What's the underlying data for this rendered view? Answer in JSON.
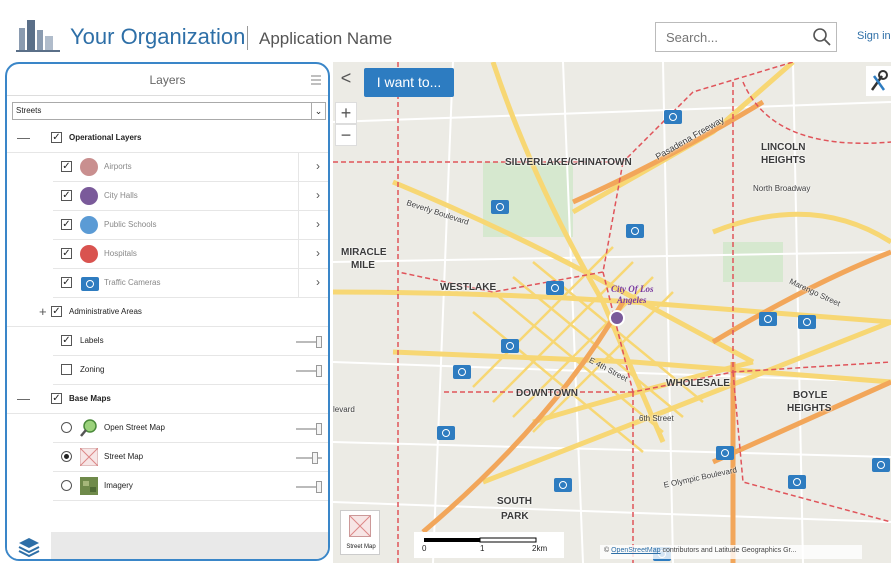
{
  "header": {
    "org_name": "Your Organization",
    "app_name": "Application Name",
    "search_placeholder": "Search...",
    "signin": "Sign in"
  },
  "map": {
    "i_want_to": "I want to...",
    "zoom_in": "+",
    "zoom_out": "−",
    "collapse": "<",
    "labels": {
      "silverlake": "SILVERLAKE/CHINATOWN",
      "lincoln1": "LINCOLN",
      "lincoln2": "HEIGHTS",
      "north_broadway": "North Broadway",
      "miracle1": "MIRACLE",
      "miracle2": "MILE",
      "westlake": "WESTLAKE",
      "downtown": "DOWNTOWN",
      "wholesale": "WHOLESALE",
      "boyle1": "BOYLE",
      "boyle2": "HEIGHTS",
      "south1": "SOUTH",
      "south2": "PARK",
      "beverly": "Beverly Boulevard",
      "pasadena": "Pasadena Freeway",
      "sixth": "6th Street",
      "olympic": "E Olympic Boulevard",
      "fourth": "E 4th Street",
      "marengo": "Marengo Street",
      "levard": "levard",
      "city_of1": "City Of Los",
      "city_of2": "Angeles"
    },
    "basemap_thumb_label": "Street Map",
    "scale": {
      "start": "0",
      "mid": "1",
      "end": "2km"
    },
    "attribution_link": "OpenStreetMap",
    "attribution_text": " contributors and Latitude Geographics Gr..."
  },
  "layers_panel": {
    "title": "Layers",
    "basemap_select": "Streets",
    "operational_group": "Operational Layers",
    "layers": [
      {
        "label": "Airports",
        "color": "#c98f8f"
      },
      {
        "label": "City Halls",
        "color": "#7a5a9a"
      },
      {
        "label": "Public Schools",
        "color": "#5b9bd5"
      },
      {
        "label": "Hospitals",
        "color": "#d9534f"
      },
      {
        "label": "Traffic Cameras",
        "color": "#2e7cc0"
      }
    ],
    "admin_areas": "Administrative Areas",
    "labels_item": "Labels",
    "zoning_item": "Zoning",
    "base_group": "Base Maps",
    "base_maps": [
      {
        "label": "Open Street Map",
        "selected": false
      },
      {
        "label": "Street Map",
        "selected": true
      },
      {
        "label": "Imagery",
        "selected": false
      }
    ]
  }
}
